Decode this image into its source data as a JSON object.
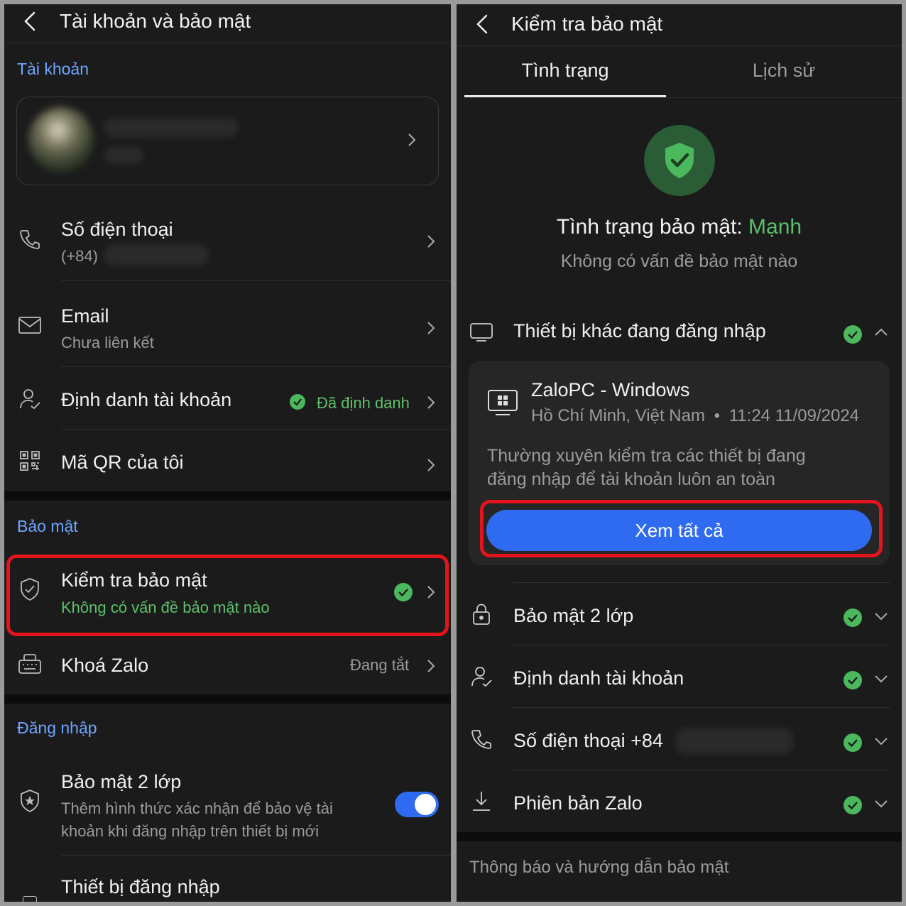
{
  "left": {
    "header_title": "Tài khoản và bảo mật",
    "account_section": "Tài khoản",
    "phone": {
      "title": "Số điện thoại",
      "value": "(+84)"
    },
    "email": {
      "title": "Email",
      "value": "Chưa liên kết"
    },
    "identity": {
      "title": "Định danh tài khoản",
      "status": "Đã định danh"
    },
    "qr": {
      "title": "Mã QR của tôi"
    },
    "security_section": "Bảo mật",
    "security_check": {
      "title": "Kiểm tra bảo mật",
      "subtitle": "Không có vấn đề bảo mật nào"
    },
    "lock": {
      "title": "Khoá Zalo",
      "status": "Đang tắt"
    },
    "login_section": "Đăng nhập",
    "two_factor": {
      "title": "Bảo mật 2 lớp",
      "desc_line1": "Thêm hình thức xác nhận để bảo vệ tài",
      "desc_line2": "khoản khi đăng nhập trên thiết bị mới",
      "enabled": true
    },
    "devices": {
      "title": "Thiết bị đăng nhập"
    }
  },
  "right": {
    "header_title": "Kiểm tra bảo mật",
    "tabs": [
      {
        "label": "Tình trạng",
        "active": true
      },
      {
        "label": "Lịch sử",
        "active": false
      }
    ],
    "status_label": "Tình trạng bảo mật:",
    "status_value": "Mạnh",
    "status_sub": "Không có vấn đề bảo mật nào",
    "other_devices": {
      "title": "Thiết bị khác đang đăng nhập"
    },
    "device_card": {
      "name": "ZaloPC - Windows",
      "location": "Hồ Chí Minh, Việt Nam",
      "time": "11:24 11/09/2024",
      "tip_line1": "Thường xuyên kiểm tra các thiết bị đang",
      "tip_line2": "đăng nhập để tài khoản luôn an toàn",
      "button": "Xem tất cả"
    },
    "items": {
      "two_factor": "Bảo mật 2 lớp",
      "identity": "Định danh tài khoản",
      "phone": "Số điện thoại +84",
      "version": "Phiên bản Zalo"
    },
    "footer": "Thông báo và hướng dẫn bảo mật"
  },
  "colors": {
    "accent_blue": "#2f6bf0",
    "link_blue": "#6da6ff",
    "green": "#4cb85d",
    "highlight_red": "#e3141c"
  }
}
